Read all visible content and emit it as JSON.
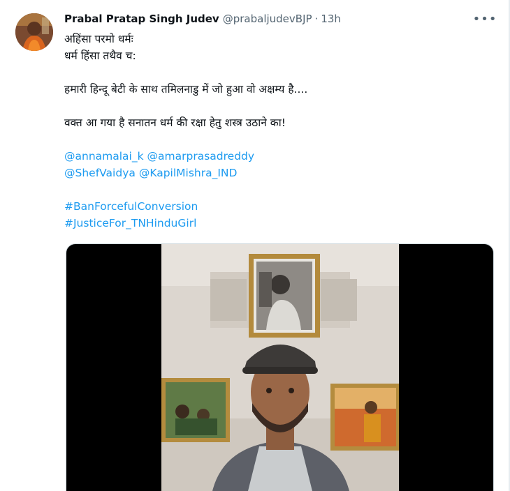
{
  "tweet": {
    "author_name": "Prabal Pratap Singh Judev",
    "author_handle": "@prabaljudevBJP",
    "separator": "·",
    "time": "13h",
    "more_icon": "more-horizontal-icon",
    "text_lines": [
      "अहिंसा परमो धर्मः",
      "धर्म हिंसा तथैव च:"
    ],
    "paragraph_2": "हमारी हिन्दू बेटी के साथ तमिलनाडु में जो हुआ वो अक्षम्य है....",
    "paragraph_3": "वक्त आ गया है सनातन धर्म की रक्षा हेतु शस्त्र उठाने का!",
    "mentions": [
      "@annamalai_k",
      "@amarprasadreddy",
      "@ShefVaidya",
      "@KapilMishra_IND"
    ],
    "hashtags": [
      "#BanForcefulConversion",
      "#JusticeFor_TNHinduGirl"
    ]
  },
  "colors": {
    "text": "#0f1419",
    "secondary": "#536471",
    "link": "#1d9bf0",
    "media_background": "#000000"
  },
  "media": {
    "type": "video"
  }
}
